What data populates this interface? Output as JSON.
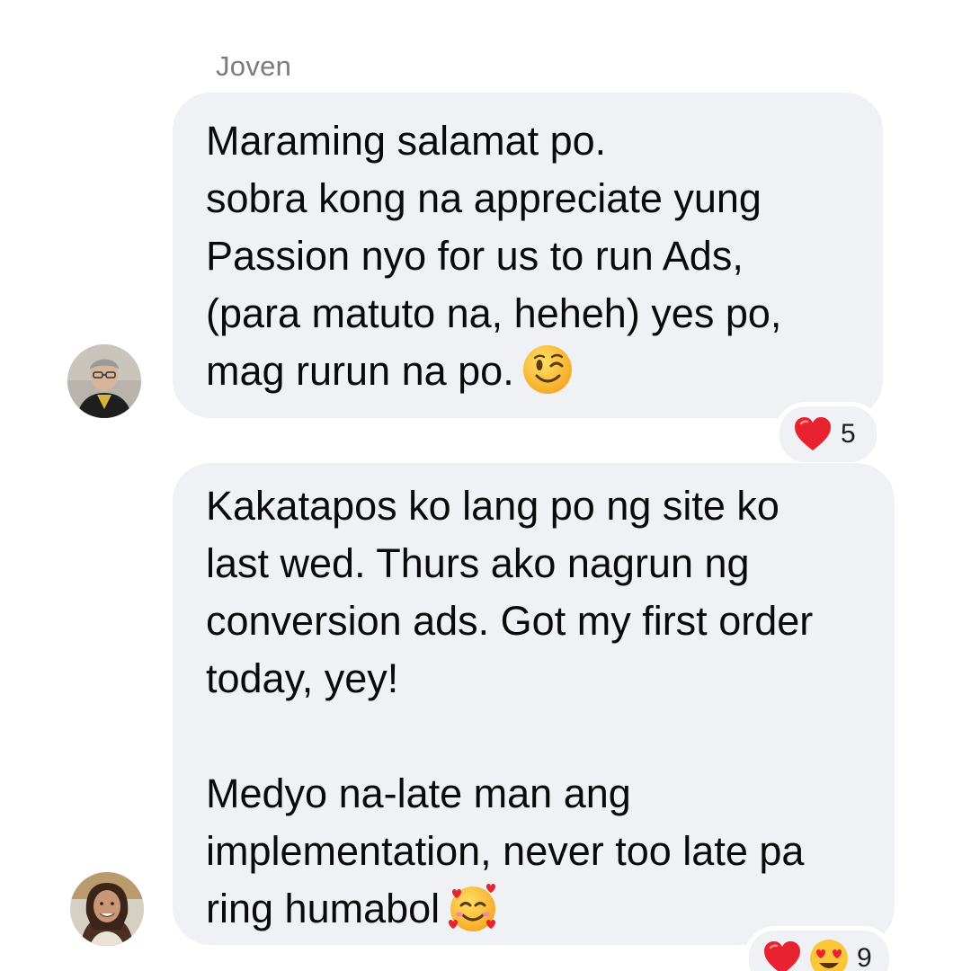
{
  "thread": {
    "sender_name": "Joven",
    "messages": [
      {
        "lines": [
          "Maraming salamat po.",
          "sobra kong na appreciate yung",
          "Passion nyo for us to run Ads,",
          "(para matuto na, heheh) yes po,",
          "mag rurun na po."
        ],
        "emoji": "winking-face",
        "reactions": {
          "icons": [
            "heart"
          ],
          "count": "5"
        }
      },
      {
        "lines": [
          "Kakatapos ko lang po ng site ko",
          "last wed. Thurs ako nagrun ng",
          "conversion ads. Got my first order",
          "today, yey!",
          "",
          "Medyo na-late man ang",
          "implementation, never too late pa",
          "ring humabol"
        ],
        "emoji": "smiling-face-with-hearts",
        "reactions": {
          "icons": [
            "heart",
            "heart-eyes"
          ],
          "count": "9"
        }
      }
    ]
  },
  "colors": {
    "bubble": "#f0f1f4",
    "sender_name": "#7c7c80",
    "text": "#0a0a0a",
    "heart": "#e8232f"
  }
}
